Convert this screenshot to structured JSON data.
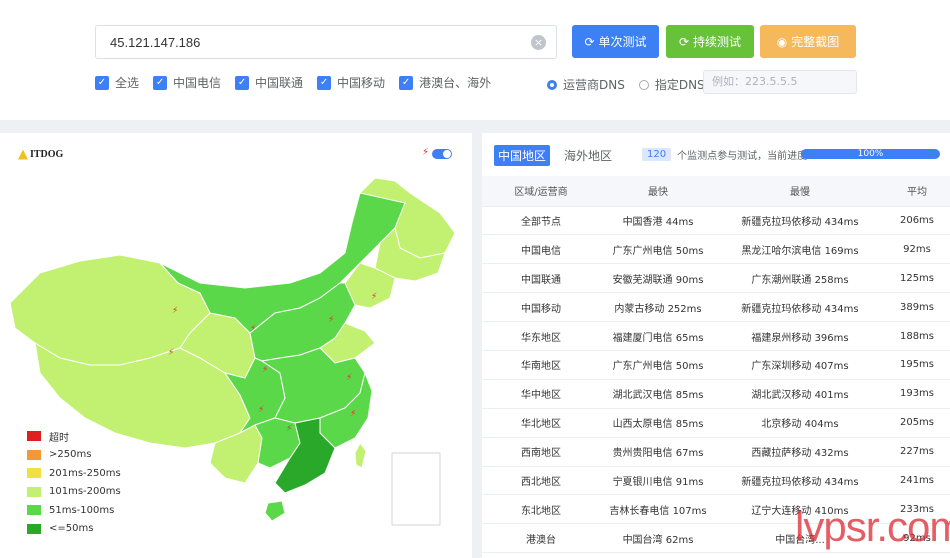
{
  "search": {
    "value": "45.121.147.186"
  },
  "buttons": {
    "single": "单次测试",
    "continuous": "持续测试",
    "screenshot": "完整截图"
  },
  "filters": [
    {
      "label": "全选",
      "checked": true
    },
    {
      "label": "中国电信",
      "checked": true
    },
    {
      "label": "中国联通",
      "checked": true
    },
    {
      "label": "中国移动",
      "checked": true
    },
    {
      "label": "港澳台、海外",
      "checked": true
    }
  ],
  "dns": {
    "option1": "运营商DNS",
    "option2": "指定DNS:",
    "selected": "运营商DNS",
    "placeholder": "例如：223.5.5.5"
  },
  "map": {
    "logo": "ITDOG",
    "legend": [
      {
        "label": "超时",
        "color": "#e02020"
      },
      {
        "label": ">250ms",
        "color": "#f29838"
      },
      {
        "label": "201ms-250ms",
        "color": "#f0e040"
      },
      {
        "label": "101ms-200ms",
        "color": "#c2f070"
      },
      {
        "label": "51ms-100ms",
        "color": "#5ad84a"
      },
      {
        "label": "<=50ms",
        "color": "#2aa82a"
      }
    ]
  },
  "tabs": {
    "domestic": "中国地区",
    "overseas": "海外地区"
  },
  "progress": {
    "count": "120",
    "text": "个监测点参与测试，当前进度：",
    "percent": "100%",
    "fraction": 1.0
  },
  "table": {
    "headers": [
      "区域/运营商",
      "最快",
      "最慢",
      "平均"
    ],
    "rows": [
      [
        "全部节点",
        "中国香港 44ms",
        "新疆克拉玛依移动 434ms",
        "206ms"
      ],
      [
        "中国电信",
        "广东广州电信 50ms",
        "黑龙江哈尔滨电信 169ms",
        "92ms"
      ],
      [
        "中国联通",
        "安徽芜湖联通 90ms",
        "广东潮州联通 258ms",
        "125ms"
      ],
      [
        "中国移动",
        "内蒙古移动 252ms",
        "新疆克拉玛依移动 434ms",
        "389ms"
      ],
      [
        "华东地区",
        "福建厦门电信 65ms",
        "福建泉州移动 396ms",
        "188ms"
      ],
      [
        "华南地区",
        "广东广州电信 50ms",
        "广东深圳移动 407ms",
        "195ms"
      ],
      [
        "华中地区",
        "湖北武汉电信 85ms",
        "湖北武汉移动 401ms",
        "193ms"
      ],
      [
        "华北地区",
        "山西太原电信 85ms",
        "北京移动 404ms",
        "205ms"
      ],
      [
        "西南地区",
        "贵州贵阳电信 67ms",
        "西藏拉萨移动 432ms",
        "227ms"
      ],
      [
        "西北地区",
        "宁夏银川电信 91ms",
        "新疆克拉玛依移动 434ms",
        "241ms"
      ],
      [
        "东北地区",
        "吉林长春电信 107ms",
        "辽宁大连移动 410ms",
        "233ms"
      ],
      [
        "港澳台",
        "中国台湾 62ms",
        "中国台湾...",
        "92ms"
      ]
    ]
  },
  "watermark": "lvpsr.com"
}
